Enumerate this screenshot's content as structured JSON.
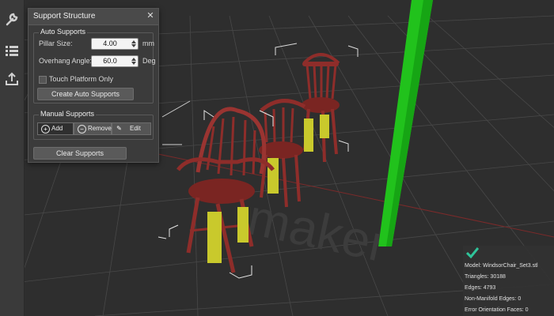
{
  "support_panel": {
    "title": "Support Structure",
    "close_glyph": "✕",
    "auto": {
      "title": "Auto Supports",
      "pillar_size": {
        "label": "Pillar Size:",
        "value": "4.00",
        "unit": "mm"
      },
      "overhang_angle": {
        "label": "Overhang Angle:",
        "value": "60.0",
        "unit": "Deg"
      },
      "touch_platform_only": {
        "label": "Touch Platform Only",
        "checked": false
      },
      "create_button": "Create Auto Supports"
    },
    "manual": {
      "title": "Manual Supports",
      "add_label": "Add",
      "remove_label": "Remove",
      "edit_label": "Edit"
    },
    "clear_button": "Clear Supports"
  },
  "tool_rail": {
    "items": [
      "wrench-icon",
      "list-icon",
      "export-icon"
    ]
  },
  "viewport": {
    "watermark": "maker",
    "colors": {
      "model": "#8e2d2a",
      "support": "#c9c92c",
      "pillar": "#21c21c",
      "grid": "#4a4a4a",
      "background": "#2e2e2e"
    }
  },
  "stats": {
    "status_icon": "check-icon",
    "model": "Model: WindsorChair_Set3.stl",
    "triangles": "Triangles: 30188",
    "edges": "Edges: 4793",
    "non_manifold": "Non-Manifold Edges: 0",
    "error_orientation": "Error Orientation Faces: 0"
  }
}
